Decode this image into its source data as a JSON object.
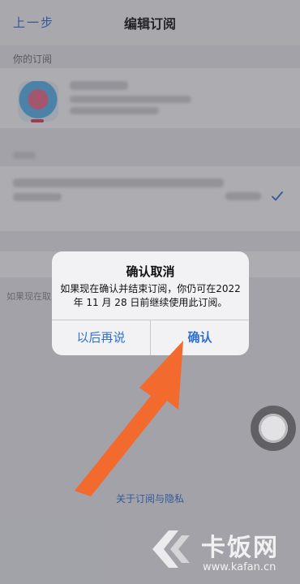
{
  "nav": {
    "back_label": "上一步",
    "title": "编辑订阅"
  },
  "subscriptions_header": "你的订阅",
  "background_partial_text": "如果现在取",
  "privacy_link": "关于订阅与隐私",
  "alert": {
    "title": "确认取消",
    "message": "如果现在确认并结束订阅，你仍可在2022 年 11 月 28 日前继续使用此订阅。",
    "later_button": "以后再说",
    "confirm_button": "确认"
  },
  "watermark": {
    "brand": "卡饭网",
    "url": "www.kafan.cn"
  },
  "colors": {
    "accent": "#2f6fd6",
    "arrow": "#f26a2e"
  },
  "icons": [
    "check-icon",
    "app-icon",
    "assistive-touch-icon",
    "arrow-annotation",
    "watermark-logo-icon"
  ]
}
